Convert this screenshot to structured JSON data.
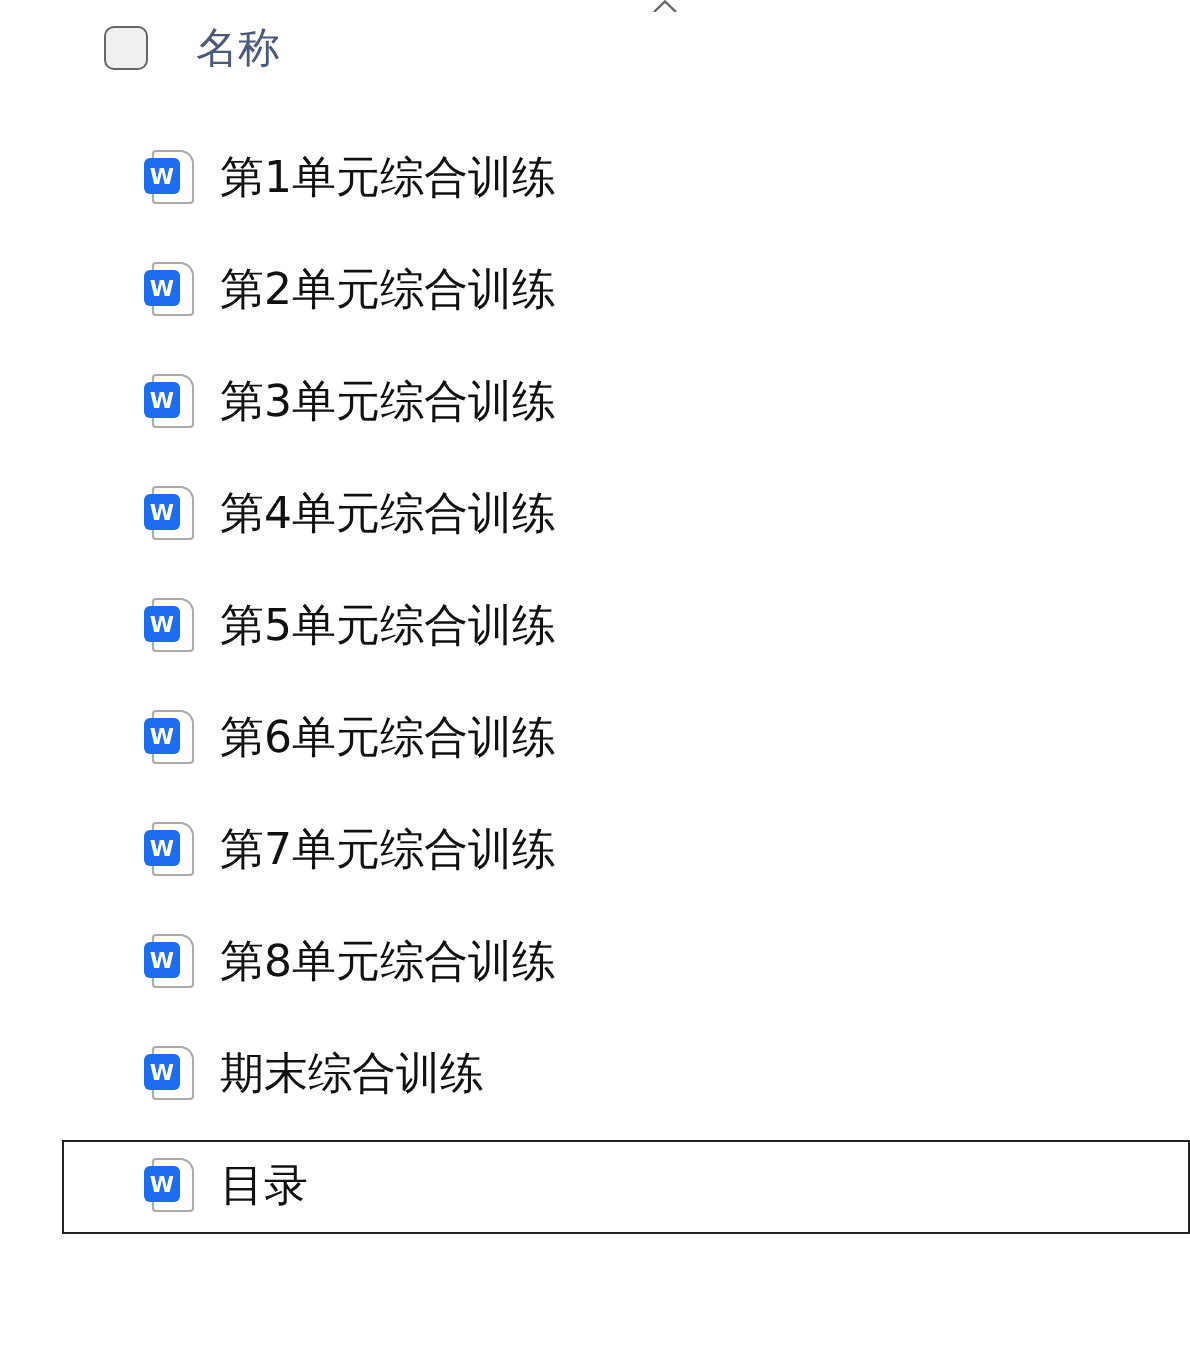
{
  "header": {
    "checked": false,
    "column": "名称"
  },
  "files": [
    {
      "name": "第1单元综合训练",
      "icon_text": "W",
      "selected": false
    },
    {
      "name": "第2单元综合训练",
      "icon_text": "W",
      "selected": false
    },
    {
      "name": "第3单元综合训练",
      "icon_text": "W",
      "selected": false
    },
    {
      "name": "第4单元综合训练",
      "icon_text": "W",
      "selected": false
    },
    {
      "name": "第5单元综合训练",
      "icon_text": "W",
      "selected": false
    },
    {
      "name": "第6单元综合训练",
      "icon_text": "W",
      "selected": false
    },
    {
      "name": "第7单元综合训练",
      "icon_text": "W",
      "selected": false
    },
    {
      "name": "第8单元综合训练",
      "icon_text": "W",
      "selected": false
    },
    {
      "name": "期末综合训练",
      "icon_text": "W",
      "selected": false
    },
    {
      "name": "目录",
      "icon_text": "W",
      "selected": true
    }
  ]
}
